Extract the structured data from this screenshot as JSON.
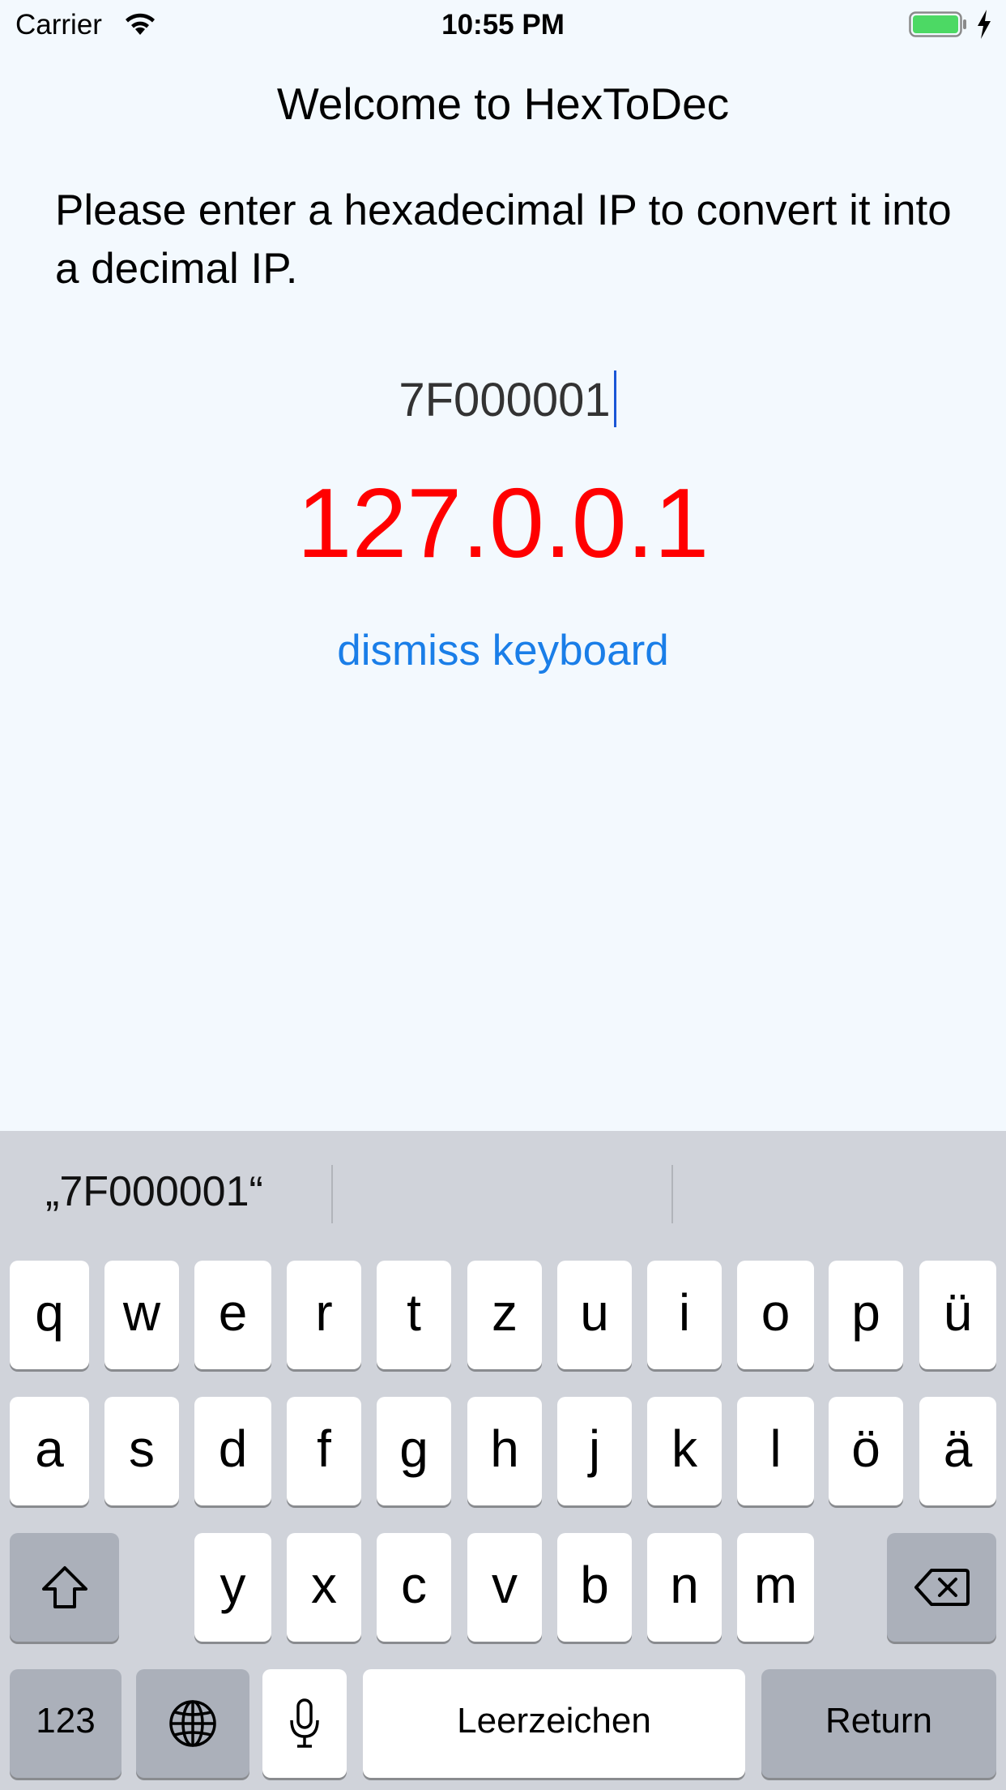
{
  "status_bar": {
    "carrier": "Carrier",
    "time": "10:55 PM",
    "wifi_icon": "wifi-icon",
    "battery_icon": "battery-icon",
    "charging_icon": "bolt-icon"
  },
  "app": {
    "title": "Welcome to HexToDec",
    "instructions": "Please enter a hexadecimal IP to convert it into a decimal IP.",
    "hex_input_value": "7F000001",
    "result": "127.0.0.1",
    "result_color": "#ff0000",
    "dismiss_label": "dismiss keyboard",
    "link_color": "#1a7ee8"
  },
  "keyboard": {
    "suggestions": [
      "„7F000001“",
      "",
      ""
    ],
    "row1": [
      "q",
      "w",
      "e",
      "r",
      "t",
      "z",
      "u",
      "i",
      "o",
      "p",
      "ü"
    ],
    "row2": [
      "a",
      "s",
      "d",
      "f",
      "g",
      "h",
      "j",
      "k",
      "l",
      "ö",
      "ä"
    ],
    "row3": [
      "y",
      "x",
      "c",
      "v",
      "b",
      "n",
      "m"
    ],
    "shift_icon": "shift-icon",
    "delete_icon": "delete-icon",
    "numbers_label": "123",
    "globe_icon": "globe-icon",
    "mic_icon": "microphone-icon",
    "space_label": "Leerzeichen",
    "return_label": "Return"
  }
}
